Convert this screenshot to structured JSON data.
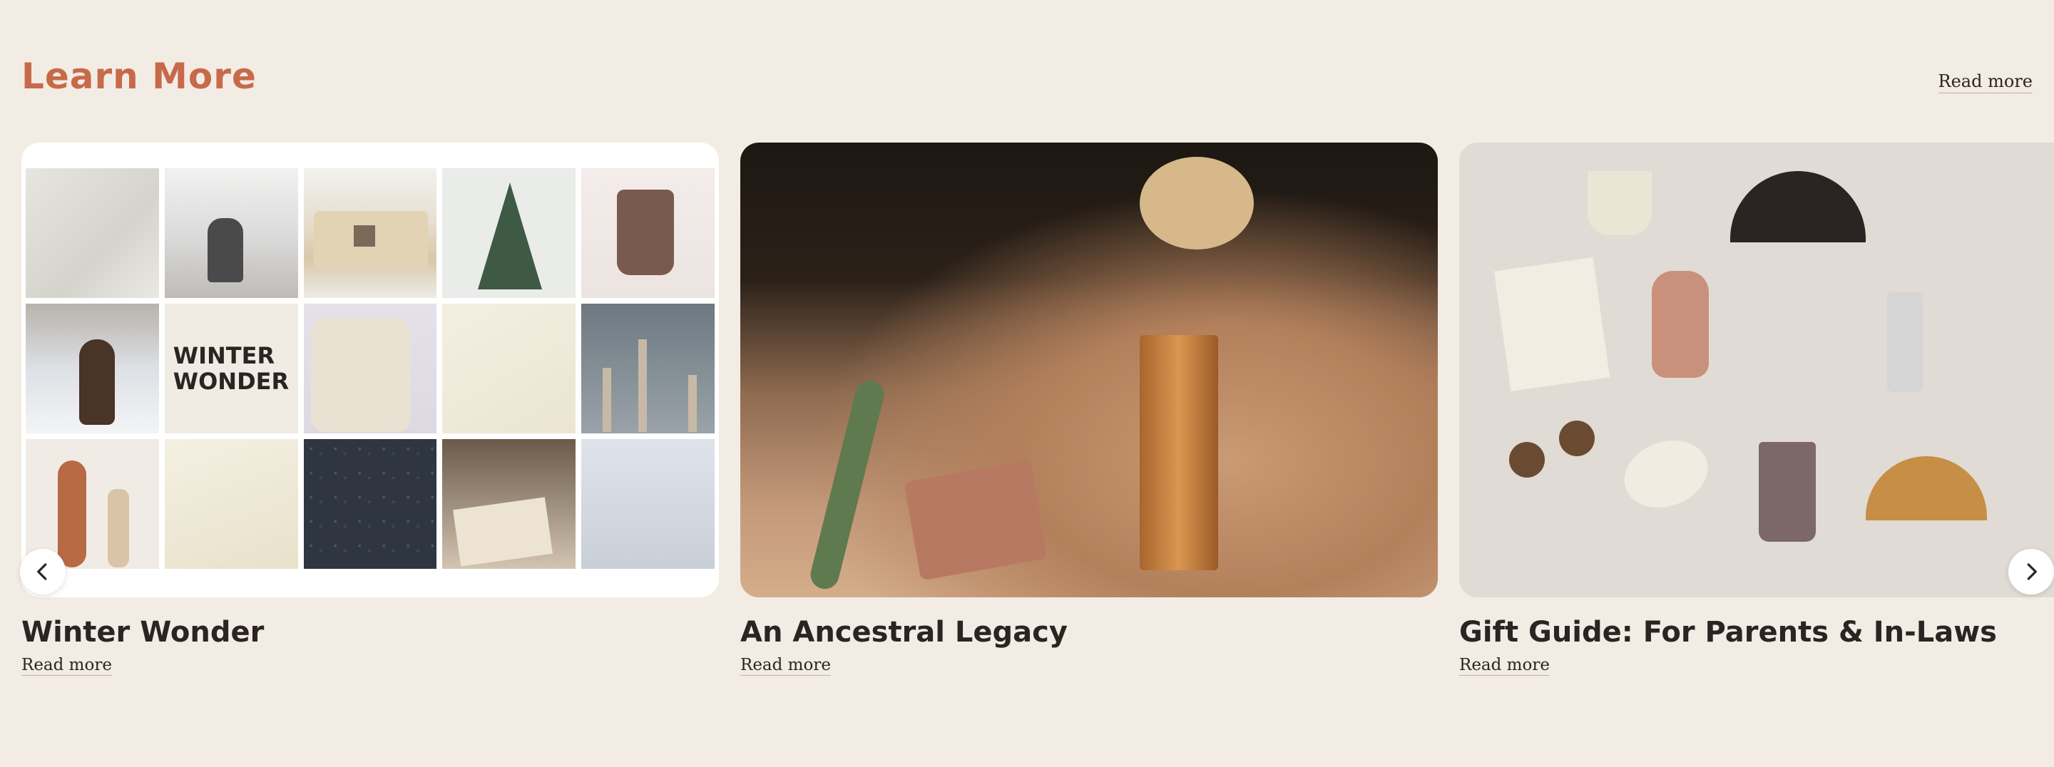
{
  "section": {
    "title": "Learn More",
    "read_more_label": "Read more"
  },
  "cards": [
    {
      "title": "Winter Wonder",
      "link_label": "Read more",
      "collage_word": "WINTER\nWONDER"
    },
    {
      "title": "An Ancestral Legacy",
      "link_label": "Read more"
    },
    {
      "title": "Gift Guide: For Parents & In-Laws",
      "link_label": "Read more"
    }
  ],
  "controls": {
    "prev_icon": "chevron-left-icon",
    "next_icon": "chevron-right-icon"
  },
  "colors": {
    "background": "#f3ece5",
    "title_accent": "#c76a4a",
    "text": "#2b2422"
  }
}
